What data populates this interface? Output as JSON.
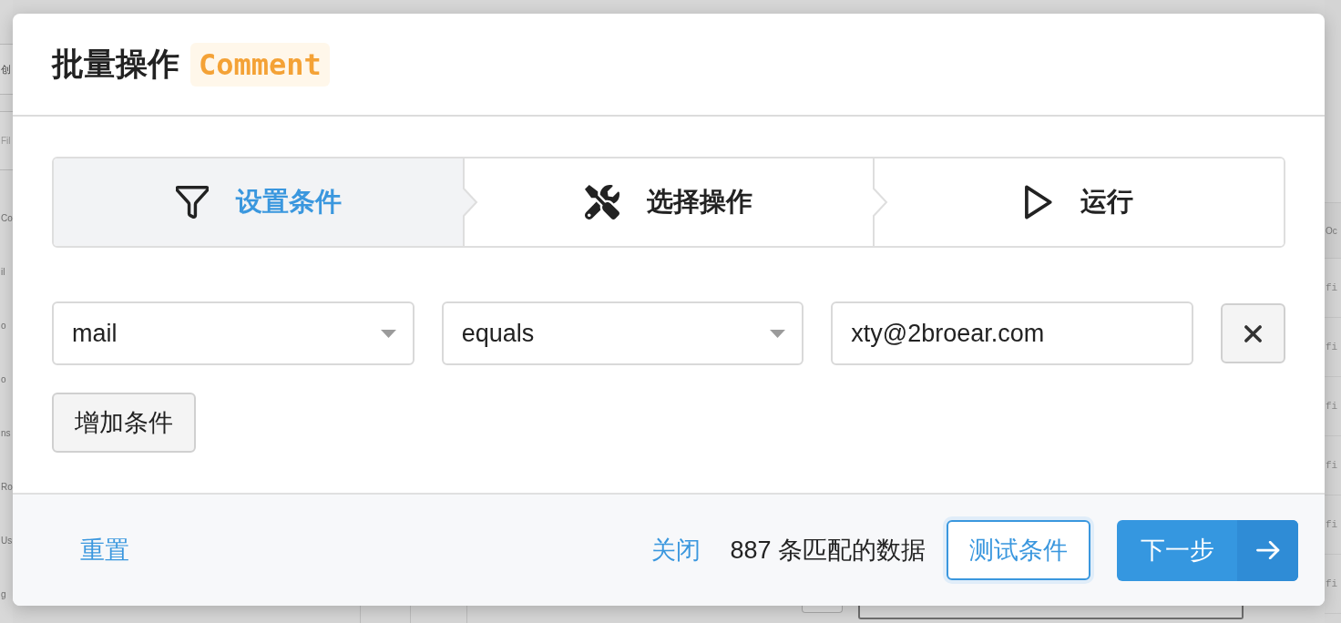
{
  "background_page": {
    "toolbar_button": "创",
    "filter_field": {
      "placeholder": "Fil"
    },
    "sidebar_items": [
      "Co",
      "il",
      "o",
      "o",
      "ns",
      "Ro",
      "Us",
      "g"
    ],
    "table": {
      "header": "Oc",
      "cells": [
        "fi",
        "fi",
        "fi",
        "fi",
        "fi",
        "fi"
      ]
    }
  },
  "dialog": {
    "title": "批量操作",
    "badge": "Comment"
  },
  "steps": [
    {
      "label": "设置条件",
      "selected": true
    },
    {
      "label": "选择操作",
      "selected": false
    },
    {
      "label": "运行",
      "selected": false
    }
  ],
  "conditions": [
    {
      "field": "mail",
      "operator": "equals",
      "value": "xty@2broear.com"
    }
  ],
  "add_condition_button": "增加条件",
  "footer": {
    "reset_link": "重置",
    "close_link": "关闭",
    "match_count": "887 条匹配的数据",
    "test_button": "测试条件",
    "next_button": "下一步"
  }
}
